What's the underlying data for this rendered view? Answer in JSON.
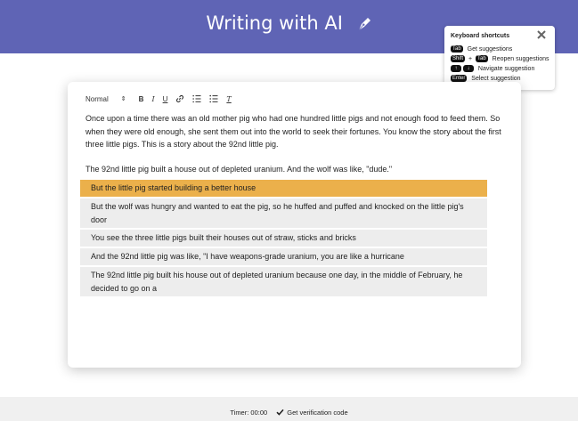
{
  "header": {
    "title": "Writing with AI",
    "icon": "pen-nib-icon",
    "background": "#5f64b5"
  },
  "shortcuts": {
    "title": "Keyboard shortcuts",
    "close_label": "✕",
    "rows": [
      {
        "keys": [
          "Tab"
        ],
        "description": "Get suggestions"
      },
      {
        "keys": [
          "Shift",
          "Tab"
        ],
        "joiner": "+",
        "description": "Reopen suggestions"
      },
      {
        "keys": [
          "↑",
          "↓"
        ],
        "description": "Navigate suggestion"
      },
      {
        "keys": [
          "Enter"
        ],
        "description": "Select suggestion"
      }
    ]
  },
  "toolbar": {
    "format_value": "Normal",
    "format_arrows": "⇕",
    "bold": "B",
    "italic": "I",
    "underline": "U",
    "clear": "T"
  },
  "document": {
    "paragraph1": "Once upon a time there was an old mother pig who had one hundred little pigs and not enough food to feed them. So when they were old enough, she sent them out into the world to seek their fortunes. You know the story about the first three little pigs. This is a story about the 92nd little pig.",
    "paragraph2": "The 92nd little pig built a house out of depleted uranium. And the wolf was like, \"dude.\""
  },
  "suggestions": [
    {
      "text": "But the little pig started building a better house",
      "selected": true
    },
    {
      "text": "But the wolf was hungry and wanted to eat the pig, so he huffed and puffed and knocked on the little pig's door",
      "selected": false
    },
    {
      "text": "You see the three little pigs built their houses out of straw, sticks and bricks",
      "selected": false
    },
    {
      "text": "And the 92nd little pig was like, \"I have weapons-grade uranium, you are like a hurricane",
      "selected": false
    },
    {
      "text": "The 92nd little pig built his house out of depleted uranium because one day, in the middle of February, he decided to go on a",
      "selected": false
    }
  ],
  "colors": {
    "selected_suggestion": "#ebb04b",
    "suggestion_bg": "#ededed"
  },
  "footer": {
    "timer": "Timer: 00:00",
    "verify": "Get verification code"
  }
}
